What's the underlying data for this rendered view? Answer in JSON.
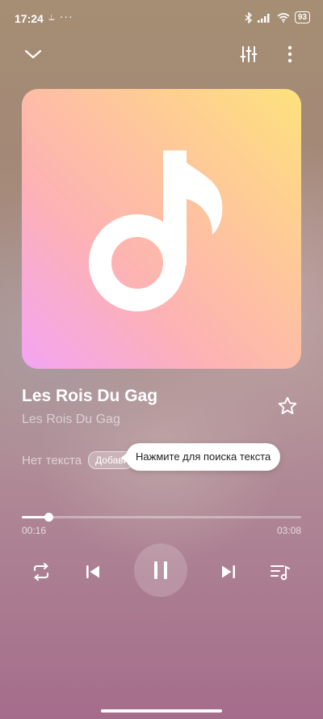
{
  "status_bar": {
    "time": "17:24",
    "extra": "⥿ ···",
    "battery": "93"
  },
  "track": {
    "title": "Les Rois Du Gag",
    "artist": "Les Rois Du Gag"
  },
  "lyrics": {
    "status": "Нет текста",
    "add_label": "Добавить"
  },
  "tooltip": {
    "text": "Нажмите для поиска текста"
  },
  "playback": {
    "elapsed": "00:16",
    "total": "03:08",
    "progress_fraction": 0.096,
    "state": "playing"
  },
  "icons": {
    "collapse": "chevron-down-icon",
    "equalizer": "equalizer-icon",
    "more": "more-vertical-icon",
    "favorite": "star-outline-icon",
    "repeat": "repeat-icon",
    "previous": "skip-previous-icon",
    "pause": "pause-icon",
    "next": "skip-next-icon",
    "queue": "playlist-icon"
  },
  "colors": {
    "accent": "#ffffff"
  }
}
